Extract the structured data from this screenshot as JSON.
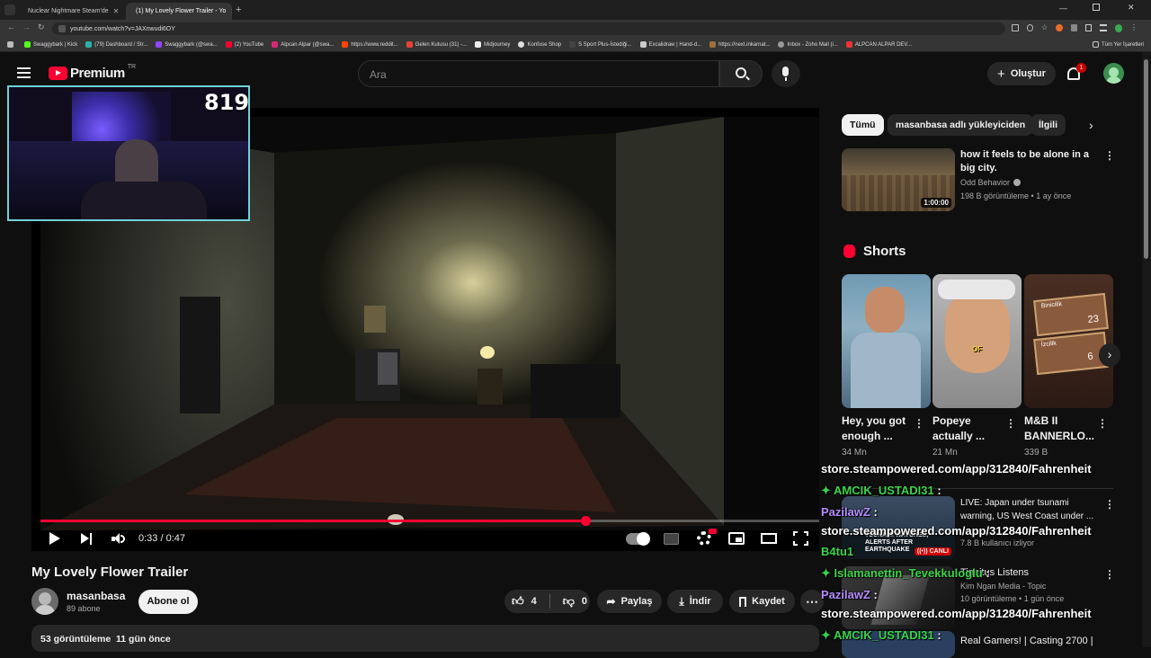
{
  "browser": {
    "tabs": [
      {
        "title": "Nuclear Nightmare Steam'de"
      },
      {
        "title": "(1) My Lovely Flower Trailer - Yo"
      }
    ],
    "url": "youtube.com/watch?v=JAXnwudi6OY",
    "bookmarks": [
      "Swaggybark | Kick",
      "(79) Dashboard / Str...",
      "Swaggybark (@swa...",
      "(2) YouTube",
      "Alpcan Alpar (@swa...",
      "https://www.reddit...",
      "Gelen Kutusu (31) -...",
      "Midjourney",
      "Konfuse Shop",
      "S Sport Plus-İstediği...",
      "Excalidraw | Hand-d...",
      "https://next.inkarnat...",
      "Inbox - Zoho Mail (i...",
      "ALPCAN ALPAR DEV..."
    ],
    "bookmarks_right": "Tüm Yer İşaretleri"
  },
  "youtube": {
    "logo_text": "Premium",
    "region": "TR",
    "search_placeholder": "Ara",
    "create_label": "Oluştur",
    "notif_count": "1"
  },
  "player": {
    "time": "0:33 / 0:47",
    "progress": 0.7,
    "webcam_counter": "819"
  },
  "video": {
    "title": "My Lovely Flower Trailer",
    "channel": "masanbasa",
    "subs": "89 abone",
    "subscribe_label": "Abone ol",
    "likes": "4",
    "dislikes": "0",
    "share_label": "Paylaş",
    "download_label": "İndir",
    "save_label": "Kaydet",
    "views_date": "53 görüntüleme  11 gün önce"
  },
  "chips": [
    "Tümü",
    "masanbasa adlı yükleyiciden",
    "İlgili"
  ],
  "recommend": [
    {
      "title": "how it feels to be alone in a big city.",
      "channel": "Odd Behavior",
      "meta": "198 B görüntüleme • 1 ay önce",
      "duration": "1:00:00"
    }
  ],
  "shorts": {
    "heading": "Shorts",
    "items": [
      {
        "title": "Hey, you got enough ...",
        "views": "34 Mn"
      },
      {
        "title": "Popeye actually ...",
        "views": "21 Mn"
      },
      {
        "title": "M&B II BANNERLO...",
        "views": "339 B"
      }
    ],
    "thumb_text": [
      "OF",
      "Binicilik",
      "23",
      "İzcilik",
      "6"
    ]
  },
  "live": {
    "title": "LIVE: Japan under tsunami warning, US West Coast under ...",
    "meta": "7.8 B kullanıcı izliyor",
    "badge": "CANLI",
    "thumb_text": "TSUNAMI WATCHES, ALERTS AFTER EARTHQUAKE"
  },
  "rec2": {
    "title": "Tinnitus Listens",
    "channel": "Kim Ngan Media - Topic",
    "meta": "10 görüntüleme • 1 gün önce"
  },
  "rec3": {
    "title": "Real Gamers! | Casting 2700 |"
  },
  "chat": [
    {
      "text": "store.steampowered.com/app/312840/Fahrenheit"
    },
    {
      "user": "AMCIK_USTADI31",
      "sep": ":"
    },
    {
      "user": "PazilawZ",
      "sep": ":"
    },
    {
      "text": "store.steampowered.com/app/312840/Fahrenheit"
    },
    {
      "user": "B4tu1",
      "sep": ""
    },
    {
      "user": "Islamanettin_Tevekkuloglu",
      "sep": ":"
    },
    {
      "user": "PazilawZ",
      "sep": ":"
    },
    {
      "text": "store.steampowered.com/app/312840/Fahrenheit"
    },
    {
      "user": "AMCIK_USTADI31",
      "sep": ":"
    }
  ],
  "colors": {
    "accent": "#ff0033",
    "chat_green": "#3cd44a",
    "chat_purple": "#b58cff",
    "chat_teal": "#35d0c2"
  }
}
